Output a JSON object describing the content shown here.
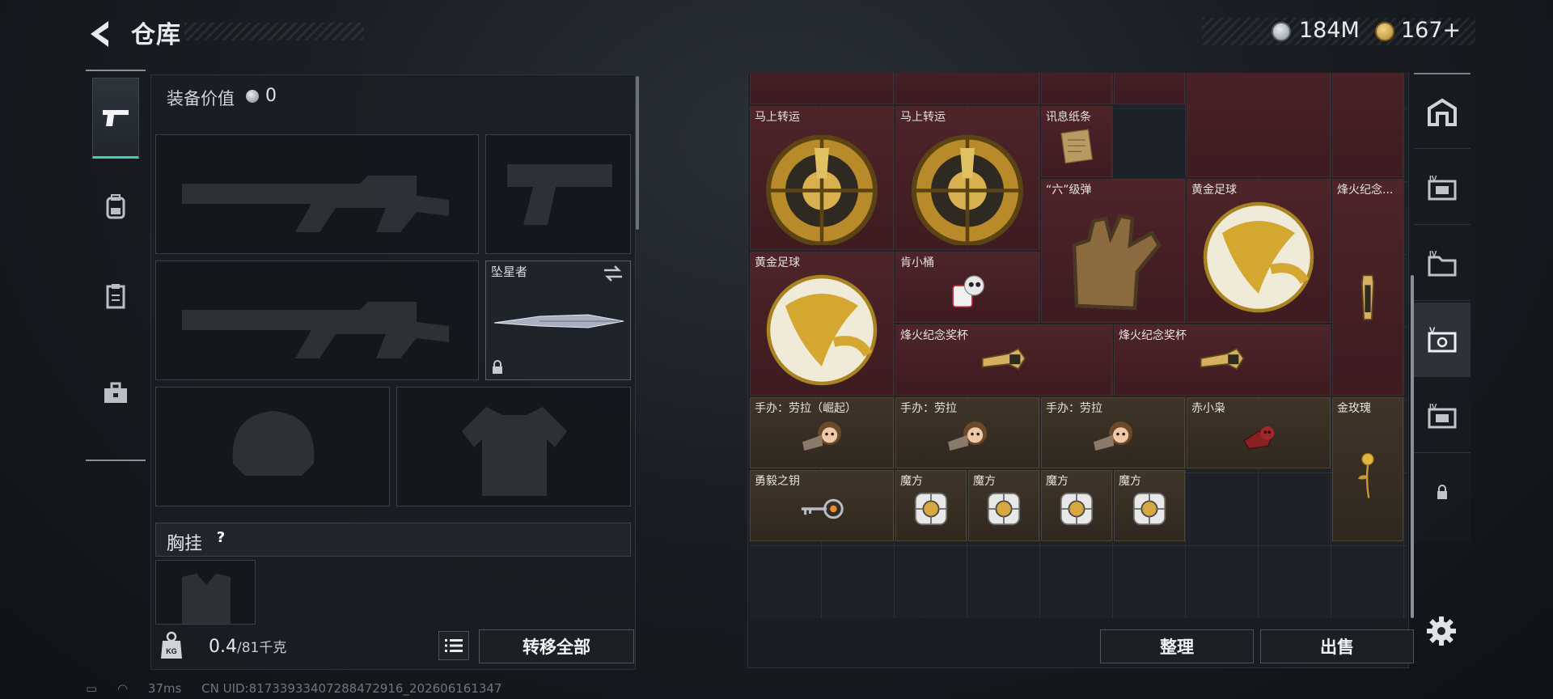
{
  "header": {
    "title": "仓库",
    "currency": [
      {
        "icon": "silver-coin-icon",
        "value": "184M"
      },
      {
        "icon": "gold-coin-icon",
        "value": "167+"
      }
    ]
  },
  "left_tabs": [
    {
      "icon": "pistol-icon",
      "active": true
    },
    {
      "icon": "backpack-icon",
      "active": false
    },
    {
      "icon": "clipboard-icon",
      "active": false
    },
    {
      "icon": "toolbox-icon",
      "active": false
    }
  ],
  "equipment": {
    "value_label": "装备价值",
    "value": "0",
    "melee_slot": {
      "name": "坠星者"
    },
    "chest_label": "胸挂",
    "chest_help": "?",
    "weight_value": "0.4",
    "weight_capacity": "/81千克",
    "transfer_all": "转移全部"
  },
  "inventory": {
    "top_partial_items": [
      "",
      "",
      "",
      "",
      "",
      ""
    ],
    "items": [
      {
        "label": "马上转运",
        "art": "wheel"
      },
      {
        "label": "马上转运",
        "art": "wheel"
      },
      {
        "label": "讯息纸条",
        "art": "note"
      },
      {
        "label": "“六”级弹",
        "art": "glove"
      },
      {
        "label": "黄金足球",
        "art": "ball"
      },
      {
        "label": "烽火纪念...",
        "art": "pillar"
      },
      {
        "label": "黄金足球",
        "art": "ball"
      },
      {
        "label": "肯小桶",
        "art": "bucket"
      },
      {
        "label": "烽火纪念奖杯",
        "art": "trophy"
      },
      {
        "label": "烽火纪念奖杯",
        "art": "trophy"
      },
      {
        "label": "手办：劳拉（崛起）",
        "art": "figure"
      },
      {
        "label": "手办：劳拉",
        "art": "figure"
      },
      {
        "label": "手办：劳拉",
        "art": "figure"
      },
      {
        "label": "赤小枭",
        "art": "owl"
      },
      {
        "label": "金玫瑰",
        "art": "rose"
      },
      {
        "label": "勇毅之钥",
        "art": "key"
      },
      {
        "label": "魔方",
        "art": "cube"
      },
      {
        "label": "魔方",
        "art": "cube"
      },
      {
        "label": "魔方",
        "art": "cube"
      },
      {
        "label": "魔方",
        "art": "cube"
      }
    ],
    "organize": "整理",
    "sell": "出售"
  },
  "right_tabs": [
    {
      "icon": "safehouse-icon"
    },
    {
      "icon": "case-iv-icon"
    },
    {
      "icon": "case-iv-folder-icon"
    },
    {
      "icon": "case-v-icon",
      "active": true
    },
    {
      "icon": "case-iv-alt-icon"
    },
    {
      "icon": "lock-icon"
    }
  ],
  "status": {
    "ping": "37ms",
    "uid": "CN UID:8173393340728847291​6_202606161347"
  }
}
